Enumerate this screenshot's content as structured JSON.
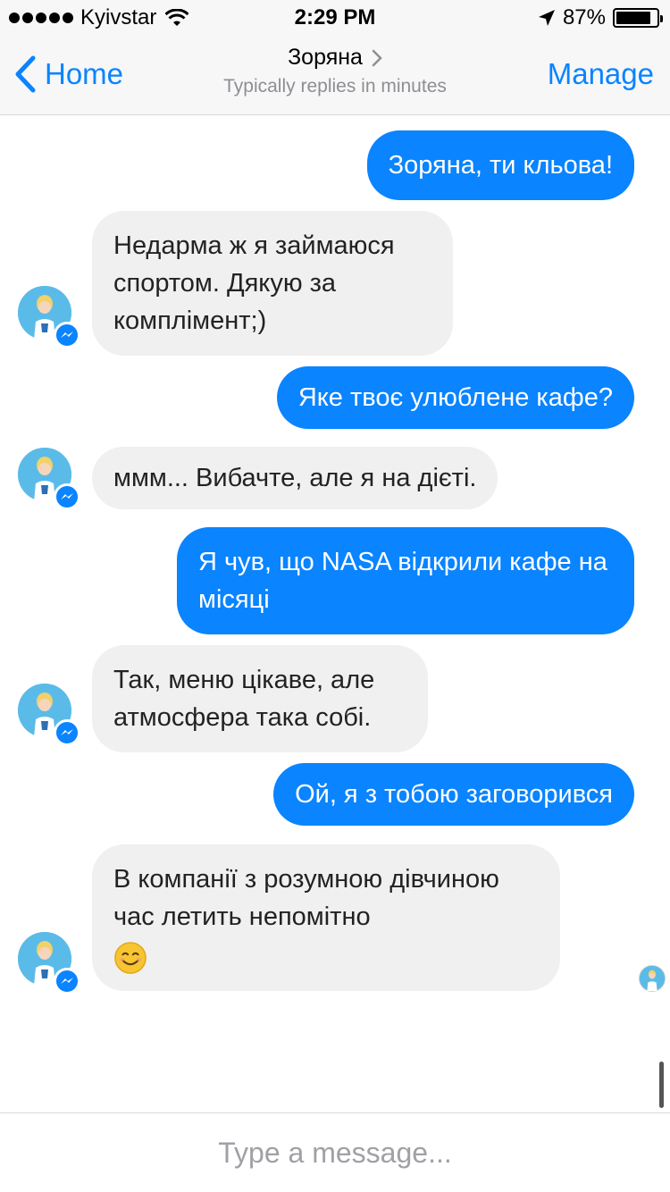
{
  "status_bar": {
    "carrier": "Kyivstar",
    "time": "2:29 PM",
    "battery": "87%",
    "battery_level": 0.87
  },
  "nav": {
    "back_label": "Home",
    "title": "Зоряна",
    "subtitle": "Typically replies in minutes",
    "manage_label": "Manage"
  },
  "messages": [
    {
      "direction": "out",
      "text": "Зоряна, ти кльова!"
    },
    {
      "direction": "in",
      "text": "Недарма ж я займаюся спортом. Дякую за комплімент;)"
    },
    {
      "direction": "out",
      "text": "Яке твоє улюблене кафе?"
    },
    {
      "direction": "in",
      "text": "ммм... Вибачте, але я на дієті."
    },
    {
      "direction": "out",
      "text": "Я чув, що NASA відкрили кафе на місяці"
    },
    {
      "direction": "in",
      "text": "Так, меню цікаве, але атмосфера така собі."
    },
    {
      "direction": "out",
      "text": "Ой, я з тобою заговорився"
    },
    {
      "direction": "in",
      "text": "В компанії з розумною дівчиною час летить непомітно",
      "emoji": "smiling-face"
    }
  ],
  "composer": {
    "placeholder": "Type a message..."
  },
  "colors": {
    "accent": "#0a84ff",
    "incoming_bubble": "#f0f0f0",
    "bar_bg": "#f7f7f8"
  }
}
